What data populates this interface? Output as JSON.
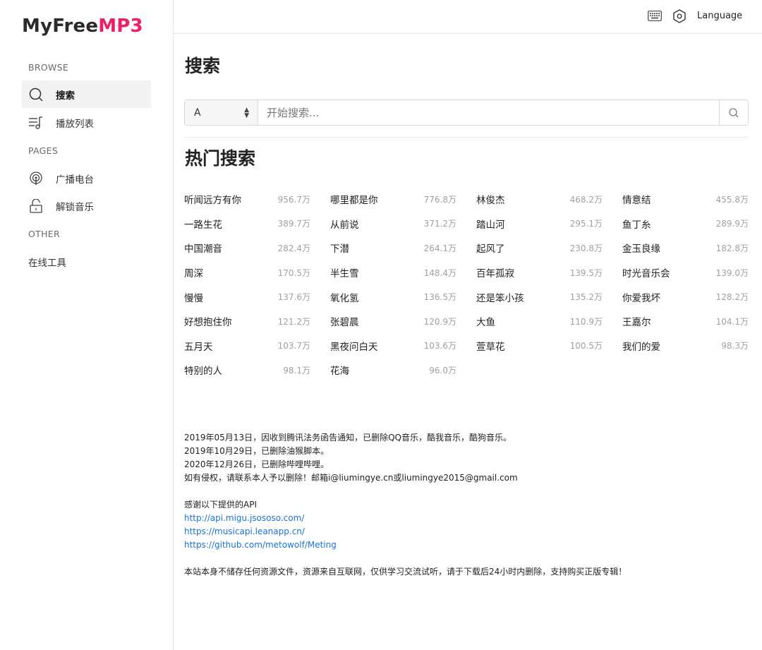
{
  "sidebar": {
    "logo_main": "MyFree",
    "logo_accent": "MP3",
    "browse_label": "BROWSE",
    "pages_label": "PAGES",
    "other_label": "OTHER",
    "items": {
      "search": "搜索",
      "playlist": "播放列表",
      "radio": "广播电台",
      "unlock": "解锁音乐",
      "tools": "在线工具"
    }
  },
  "topbar": {
    "language": "Language"
  },
  "main": {
    "title": "搜索",
    "search_source": "A",
    "search_placeholder": "开始搜索...",
    "hot_title": "热门搜索",
    "hot_items": [
      {
        "name": "听闻远方有你",
        "count": "956.7万"
      },
      {
        "name": "哪里都是你",
        "count": "776.8万"
      },
      {
        "name": "林俊杰",
        "count": "468.2万"
      },
      {
        "name": "情意结",
        "count": "455.8万"
      },
      {
        "name": "一路生花",
        "count": "389.7万"
      },
      {
        "name": "从前说",
        "count": "371.2万"
      },
      {
        "name": "踏山河",
        "count": "295.1万"
      },
      {
        "name": "鱼丁糸",
        "count": "289.9万"
      },
      {
        "name": "中国潮音",
        "count": "282.4万"
      },
      {
        "name": "下潜",
        "count": "264.1万"
      },
      {
        "name": "起风了",
        "count": "230.8万"
      },
      {
        "name": "金玉良缘",
        "count": "182.8万"
      },
      {
        "name": "周深",
        "count": "170.5万"
      },
      {
        "name": "半生雪",
        "count": "148.4万"
      },
      {
        "name": "百年孤寂",
        "count": "139.5万"
      },
      {
        "name": "时光音乐会",
        "count": "139.0万"
      },
      {
        "name": "慢慢",
        "count": "137.6万"
      },
      {
        "name": "氧化氢",
        "count": "136.5万"
      },
      {
        "name": "还是笨小孩",
        "count": "135.2万"
      },
      {
        "name": "你爱我坏",
        "count": "128.2万"
      },
      {
        "name": "好想抱住你",
        "count": "121.2万"
      },
      {
        "name": "张碧晨",
        "count": "120.9万"
      },
      {
        "name": "大鱼",
        "count": "110.9万"
      },
      {
        "name": "王嘉尔",
        "count": "104.1万"
      },
      {
        "name": "五月天",
        "count": "103.7万"
      },
      {
        "name": "黑夜问白天",
        "count": "103.6万"
      },
      {
        "name": "萱草花",
        "count": "100.5万"
      },
      {
        "name": "我们的爱",
        "count": "98.3万"
      },
      {
        "name": "特别的人",
        "count": "98.1万"
      },
      {
        "name": "花海",
        "count": "96.0万"
      }
    ]
  },
  "notice": {
    "line1": "2019年05月13日，因收到腾讯法务函告通知，已删除QQ音乐，酷我音乐，酷狗音乐。",
    "line2": "2019年10月29日，已删除油猴脚本。",
    "line3": "2020年12月26日，已删除哔哩哔哩。",
    "line4": "如有侵权，请联系本人予以删除！邮箱i@liumingye.cn或liumingye2015@gmail.com",
    "thanks": "感谢以下提供的API",
    "api1": "http://api.migu.jsososo.com/",
    "api2": "https://musicapi.leanapp.cn/",
    "api3": "https://github.com/metowolf/Meting",
    "disclaimer": "本站本身不储存任何资源文件，资源来自互联网，仅供学习交流试听，请于下载后24小时内删除，支持购买正版专辑！"
  },
  "colors": {
    "accent": "#ee1f63",
    "link": "#1a73d9",
    "muted": "#a0a0a0"
  },
  "icons": {
    "search": "search-icon",
    "playlist": "playlist-icon",
    "radio": "podcast-icon",
    "unlock": "unlock-icon",
    "keyboard": "keyboard-icon",
    "theme": "hexagon-icon"
  }
}
